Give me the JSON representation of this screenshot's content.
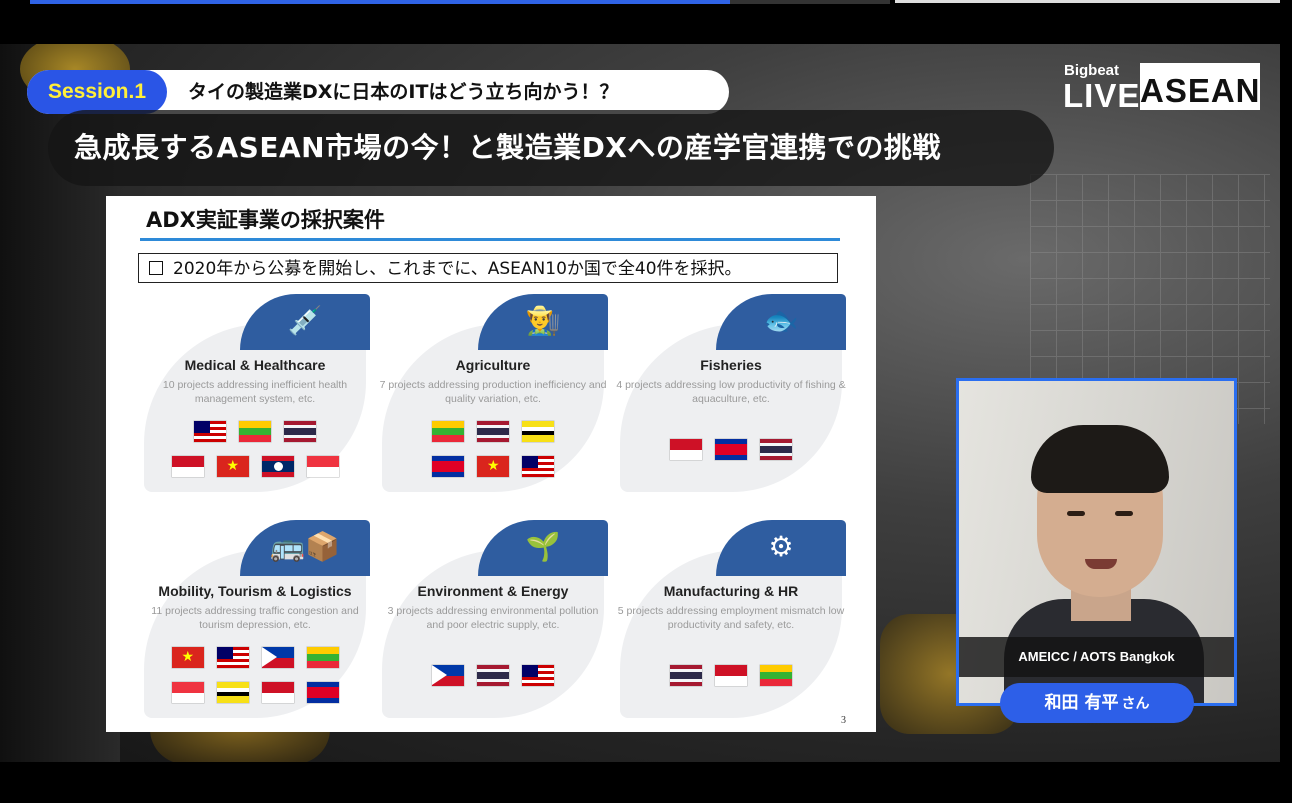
{
  "session": {
    "tag": "Session.1",
    "subtitle": "タイの製造業DXに日本のITはどう立ち向かう！？",
    "main_title": "急成長するASEAN市場の今！と製造業DXへの産学官連携での挑戦"
  },
  "brand": {
    "top": "Bigbeat",
    "live": "LIVE",
    "asean": "ASEAN"
  },
  "slide": {
    "title": "ADX実証事業の採択案件",
    "summary": "2020年から公募を開始し、これまでに、ASEAN10か国で全40件を採択。",
    "page_number": "3",
    "cards": [
      {
        "name": "Medical & Healthcare",
        "icon": "syringe-icon",
        "desc": "10 projects addressing inefficient health management system, etc.",
        "flags": [
          "malaysia",
          "myanmar",
          "thailand",
          "indonesia",
          "vietnam",
          "laos",
          "singapore"
        ]
      },
      {
        "name": "Agriculture",
        "icon": "farmer-icon",
        "desc": "7 projects addressing production inefficiency and quality variation, etc.",
        "flags": [
          "myanmar",
          "thailand",
          "brunei",
          "cambodia",
          "vietnam",
          "malaysia"
        ]
      },
      {
        "name": "Fisheries",
        "icon": "fish-hook-icon",
        "desc": "4 projects addressing low productivity of fishing & aquaculture, etc.",
        "flags": [
          "indonesia",
          "cambodia",
          "thailand"
        ]
      },
      {
        "name": "Mobility, Tourism & Logistics",
        "icon": "bus-box-icon",
        "desc": "11 projects addressing traffic congestion and tourism depression, etc.",
        "flags": [
          "vietnam",
          "malaysia",
          "philippines",
          "myanmar",
          "singapore",
          "brunei",
          "indonesia",
          "cambodia"
        ]
      },
      {
        "name": "Environment & Energy",
        "icon": "plant-hand-icon",
        "desc": "3 projects addressing environmental pollution and poor electric supply, etc.",
        "flags": [
          "philippines",
          "thailand",
          "malaysia"
        ]
      },
      {
        "name": "Manufacturing & HR",
        "icon": "gear-icon",
        "desc": "5 projects addressing employment mismatch low productivity and safety, etc.",
        "flags": [
          "thailand",
          "indonesia",
          "myanmar"
        ]
      }
    ]
  },
  "speaker": {
    "org": "AMEICC / AOTS Bangkok",
    "name": "和田 有平",
    "honorific": "さん"
  },
  "colors": {
    "accent_blue": "#2a55e6",
    "session_tag_text": "#ffef3a",
    "badge_blue": "#2f5da0",
    "rule_blue": "#2e8ad8"
  }
}
